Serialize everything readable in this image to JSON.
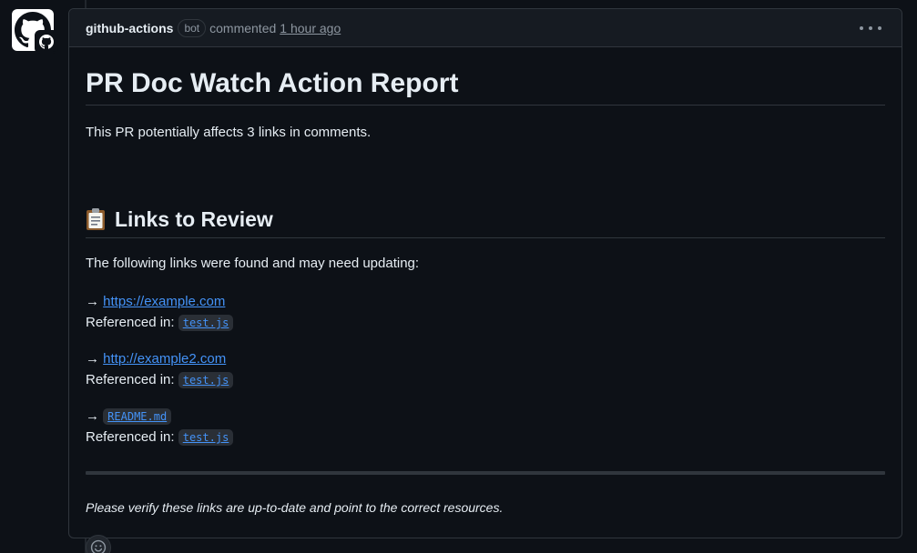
{
  "comment": {
    "author": "github-actions",
    "badge": "bot",
    "action": "commented",
    "timestamp": "1 hour ago"
  },
  "report": {
    "title": "PR Doc Watch Action Report",
    "summary": "This PR potentially affects 3 links in comments.",
    "section_title": "Links to Review",
    "section_icon": "clipboard-icon",
    "intro": "The following links were found and may need updating:",
    "arrow": "→",
    "referenced_label": "Referenced in:",
    "links": [
      {
        "url": "https://example.com",
        "is_code": false,
        "referenced_in": "test.js"
      },
      {
        "url": "http://example2.com",
        "is_code": false,
        "referenced_in": "test.js"
      },
      {
        "url": "README.md",
        "is_code": true,
        "referenced_in": "test.js"
      }
    ],
    "footer": "Please verify these links are up-to-date and point to the correct resources."
  },
  "colors": {
    "background": "#0d1117",
    "header_bg": "#161b22",
    "border": "#30363d",
    "link": "#4493f8",
    "muted": "#8d96a0",
    "text": "#e6edf3"
  },
  "icons": {
    "avatar": "github-mark-icon",
    "avatar_badge": "github-app-badge-icon",
    "menu": "kebab-horizontal-icon",
    "reaction": "smiley-icon"
  }
}
